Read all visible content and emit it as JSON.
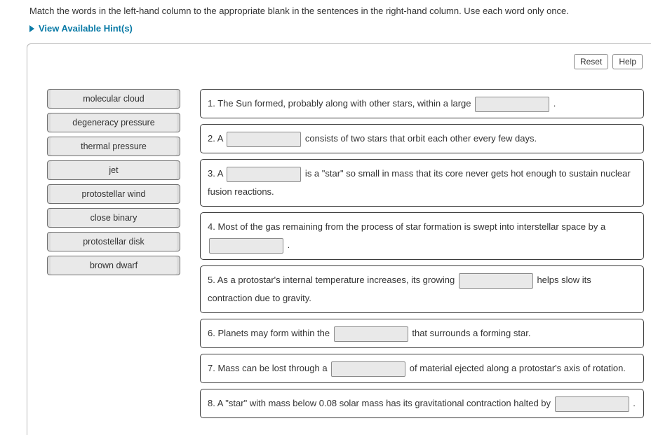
{
  "instructions": "Match the words in the left-hand column to the appropriate blank in the sentences in the right-hand column. Use each word only once.",
  "hints_label": "View Available Hint(s)",
  "buttons": {
    "reset": "Reset",
    "help": "Help"
  },
  "words": [
    "molecular cloud",
    "degeneracy pressure",
    "thermal pressure",
    "jet",
    "protostellar wind",
    "close binary",
    "protostellar disk",
    "brown dwarf"
  ],
  "sentences": {
    "s1_a": "1. The Sun formed, probably along with other stars, within a large ",
    "s1_b": " .",
    "s2_a": "2. A ",
    "s2_b": " consists of two stars that orbit each other every few days.",
    "s3_a": "3. A ",
    "s3_b": " is a \"star\" so small in mass that its core never gets hot enough to sustain nuclear fusion reactions.",
    "s4_a": "4. Most of the gas remaining from the process of star formation is swept into interstellar space by a ",
    "s4_b": " .",
    "s5_a": "5. As a protostar's internal temperature increases, its growing ",
    "s5_b": " helps slow its contraction due to gravity.",
    "s6_a": "6. Planets may form within the ",
    "s6_b": " that surrounds a forming star.",
    "s7_a": "7. Mass can be lost through a ",
    "s7_b": " of material ejected along a protostar's axis of rotation.",
    "s8_a": "8. A \"star\" with mass below 0.08 solar mass has its gravitational contraction halted by ",
    "s8_b": " ."
  }
}
